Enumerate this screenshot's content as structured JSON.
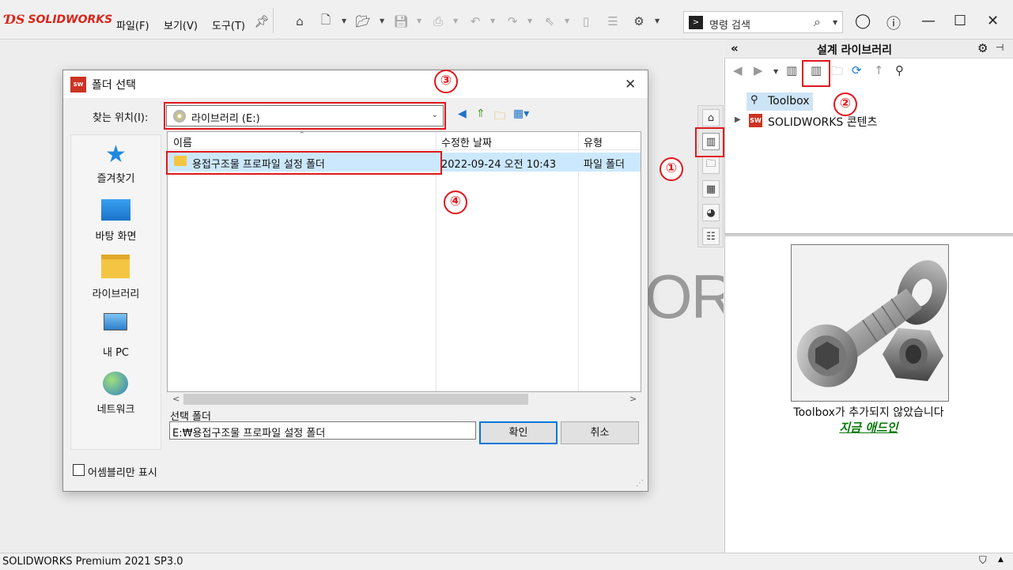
{
  "app": {
    "brand": "SOLIDWORKS",
    "menu": [
      "파일(F)",
      "보기(V)",
      "도구(T)"
    ],
    "command_search_placeholder": "명령 검색",
    "status": "SOLIDWORKS Premium 2021 SP3.0",
    "background_wordmark": "OR"
  },
  "icons": {
    "toolbar": [
      "pin-icon",
      "home-icon",
      "new-doc-icon",
      "open-icon",
      "save-icon",
      "print-icon",
      "undo-icon",
      "redo-icon",
      "select-icon",
      "rebuild-icon",
      "file-props-icon",
      "gear-icon"
    ],
    "window": [
      "account-icon",
      "help-icon",
      "minimize-icon",
      "maximize-icon",
      "close-icon"
    ]
  },
  "design_library": {
    "title": "설계 라이브러리",
    "tree": [
      {
        "label": "Toolbox",
        "selected": true
      },
      {
        "label": "SOLIDWORKS 콘텐츠",
        "selected": false
      }
    ],
    "message": "Toolbox가 추가되지 않았습니다",
    "add_link": "지금 애드인"
  },
  "dialog": {
    "title": "폴더 선택",
    "look_in_label": "찾는 위치(I):",
    "look_in_value": "라이브러리 (E:)",
    "places": [
      "즐겨찾기",
      "바탕 화면",
      "라이브러리",
      "내 PC",
      "네트워크"
    ],
    "columns": [
      "이름",
      "수정한 날짜",
      "유형"
    ],
    "rows": [
      {
        "name": "용접구조물 프로파일 설정 폴더",
        "date": "2022-09-24 오전 10:43",
        "type": "파일 폴더"
      }
    ],
    "selected_folder_label": "선택 폴더",
    "selected_folder_value": "E:₩용접구조물 프로파일 설정 폴더",
    "ok": "확인",
    "cancel": "취소",
    "assembly_only_label": "어셈블리만 표시",
    "assembly_only_checked": false
  },
  "annotations": [
    "①",
    "②",
    "③",
    "④"
  ],
  "colors": {
    "annotation": "#e0181c",
    "link": "#0b7a0b",
    "selection": "#cce8ff",
    "brand": "#d9251c"
  }
}
